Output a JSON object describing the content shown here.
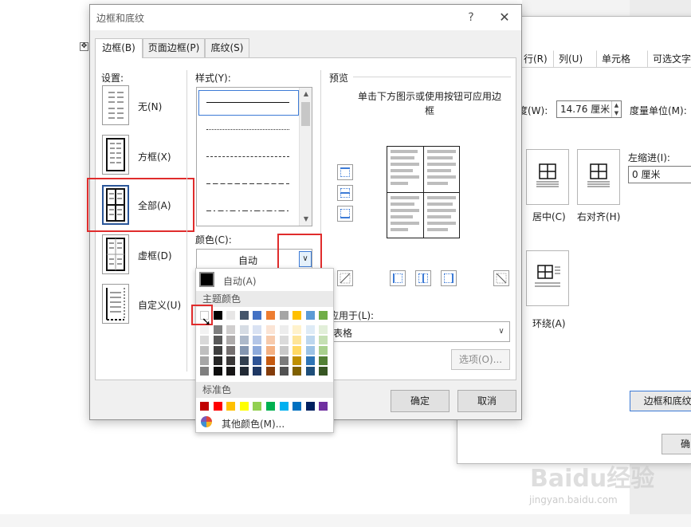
{
  "dialog": {
    "title": "边框和底纹",
    "help_glyph": "?",
    "close_glyph": "✕",
    "tabs": [
      "边框(B)",
      "页面边框(P)",
      "底纹(S)"
    ],
    "settings_label": "设置:",
    "settings": [
      {
        "label": "无(N)"
      },
      {
        "label": "方框(X)"
      },
      {
        "label": "全部(A)"
      },
      {
        "label": "虚框(D)"
      },
      {
        "label": "自定义(U)"
      }
    ],
    "style_label": "样式(Y):",
    "color_label": "颜色(C):",
    "color_value": "自动",
    "preview_label": "预览",
    "preview_hint": "单击下方图示或使用按钮可应用边框",
    "apply_label": "应用于(L):",
    "apply_value": "表格",
    "options_button": "选项(O)...",
    "ok_button": "确定",
    "cancel_button": "取消"
  },
  "color_popup": {
    "auto_label": "自动(A)",
    "theme_header": "主题颜色",
    "standard_header": "标准色",
    "more_colors": "其他颜色(M)...",
    "theme_top_row": [
      "#ffffff",
      "#000000",
      "#e7e6e6",
      "#44546a",
      "#4472c4",
      "#ed7d31",
      "#a5a5a5",
      "#ffc000",
      "#5b9bd5",
      "#70ad47"
    ],
    "theme_shades": [
      [
        "#f2f2f2",
        "#7f7f7f",
        "#d0cece",
        "#d6dce4",
        "#d9e2f3",
        "#fbe4d5",
        "#ededed",
        "#fff2cc",
        "#deebf6",
        "#e2efd9"
      ],
      [
        "#d9d9d9",
        "#595959",
        "#aeabab",
        "#adb9ca",
        "#b4c6e7",
        "#f7caac",
        "#dbdbdb",
        "#fee599",
        "#bdd7ee",
        "#c5e0b3"
      ],
      [
        "#bfbfbf",
        "#3f3f3f",
        "#757070",
        "#8496b0",
        "#8eaadb",
        "#f4b183",
        "#c9c9c9",
        "#ffd965",
        "#9cc3e5",
        "#a8d08d"
      ],
      [
        "#a6a6a6",
        "#262626",
        "#3a3838",
        "#323f4f",
        "#2f5496",
        "#c55a11",
        "#7b7b7b",
        "#bf8f00",
        "#2e75b5",
        "#538135"
      ],
      [
        "#7f7f7f",
        "#0d0d0d",
        "#171616",
        "#222a35",
        "#1f3864",
        "#833c0b",
        "#525252",
        "#7f6000",
        "#1e4e79",
        "#375623"
      ]
    ],
    "standard_colors": [
      "#c00000",
      "#ff0000",
      "#ffc000",
      "#ffff00",
      "#92d050",
      "#00b050",
      "#00b0f0",
      "#0070c0",
      "#002060",
      "#7030a0"
    ]
  },
  "background_dialog": {
    "tabs": [
      "行(R)",
      "列(U)",
      "单元格",
      "可选文字"
    ],
    "width_label": "度(W):",
    "width_value": "14.76 厘米",
    "unit_label": "度量单位(M):",
    "indent_label": "左缩进(I):",
    "indent_value": "0 厘米",
    "align_center": "居中(C)",
    "align_right": "右对齐(H)",
    "wrap_around": "环绕(A)",
    "borders_button": "边框和底纹(",
    "ok_button_partial": "确"
  },
  "watermark": {
    "logo": "Baidu经验",
    "url": "jingyan.baidu.com"
  }
}
